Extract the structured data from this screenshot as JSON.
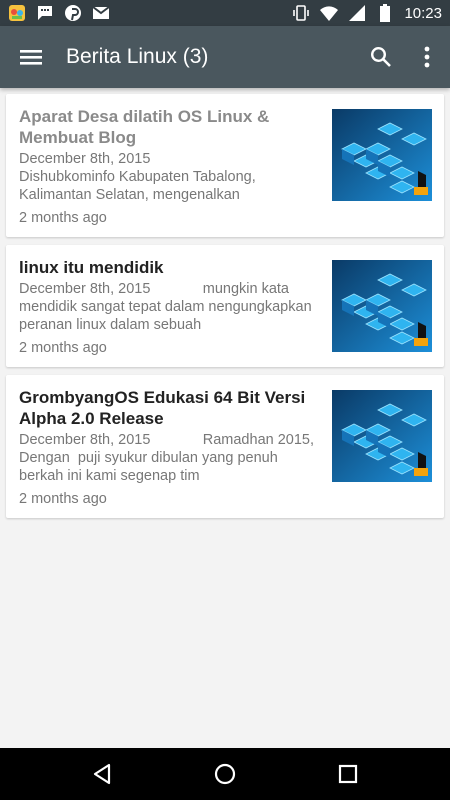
{
  "status_bar": {
    "time": "10:23",
    "left_icons": [
      "game-app-icon",
      "chat-icon",
      "pinterest-icon",
      "gmail-icon"
    ],
    "right_icons": [
      "vibrate-icon",
      "wifi-icon",
      "signal-icon",
      "battery-icon"
    ]
  },
  "app_bar": {
    "title": "Berita Linux (3)",
    "color": "#4a575e"
  },
  "articles": [
    {
      "title": "Aparat Desa dilatih OS Linux & Membuat Blog",
      "excerpt": "December 8th, 2015\nDishubkominfo Kabupaten Tabalong, Kalimantan Selatan, mengenalkan",
      "time": "2 months ago",
      "read": true
    },
    {
      "title": "linux itu mendidik",
      "excerpt": "December 8th, 2015             mungkin kata mendidik sangat tepat dalam nengungkapkan peranan linux dalam sebuah",
      "time": "2 months ago",
      "read": false
    },
    {
      "title": "GrombyangOS Edukasi 64 Bit Versi Alpha 2.0 Release",
      "excerpt": "December 8th, 2015             Ramadhan 2015, Dengan  puji syukur dibulan yang penuh berkah ini kami segenap tim",
      "time": "2 months ago",
      "read": false
    }
  ],
  "nav_bar": {
    "buttons": [
      "back-icon",
      "home-icon",
      "recents-icon"
    ]
  }
}
